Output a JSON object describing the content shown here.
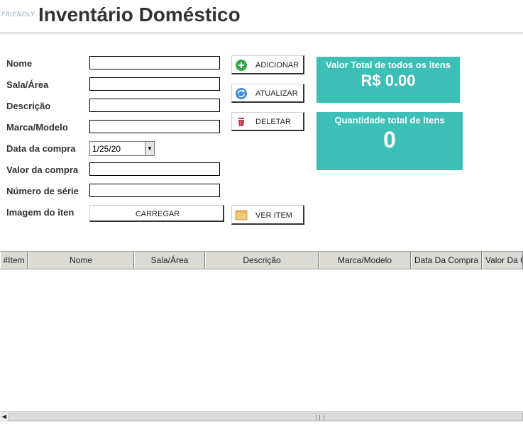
{
  "app": {
    "logo_text": "FRIENDLY",
    "title": "Inventário Doméstico"
  },
  "form": {
    "labels": {
      "nome": "Nome",
      "sala": "Sala/Área",
      "descricao": "Descrição",
      "marca": "Marca/Modelo",
      "data": "Data da compra",
      "valor": "Valor da compra",
      "serie": "Número de série",
      "imagem": "Imagem do iten"
    },
    "values": {
      "nome": "",
      "sala": "",
      "descricao": "",
      "marca": "",
      "data": "1/25/20",
      "valor": "",
      "serie": ""
    },
    "upload_button": "CARREGAR"
  },
  "actions": {
    "add": "ADICIONAR",
    "update": "ATUALIZAR",
    "delete": "DELETAR",
    "view": "VER ITEM"
  },
  "summary": {
    "total_value_label": "Valor Total de todos os itens",
    "total_value": "R$ 0.00",
    "total_qty_label": "Quantidade total de itens",
    "total_qty": "0"
  },
  "table": {
    "columns": [
      "#Item",
      "Nome",
      "Sala/Área",
      "Descrição",
      "Marca/Modelo",
      "Data Da Compra",
      "Valor Da Compra"
    ]
  },
  "colors": {
    "card": "#3dbfb8",
    "add_icon": "#3aa84a",
    "update_icon": "#3f8fd0",
    "delete_icon": "#c0324a"
  },
  "icons": {
    "add": "plus-circle-icon",
    "update": "refresh-icon",
    "delete": "trash-icon",
    "view": "box-icon"
  }
}
